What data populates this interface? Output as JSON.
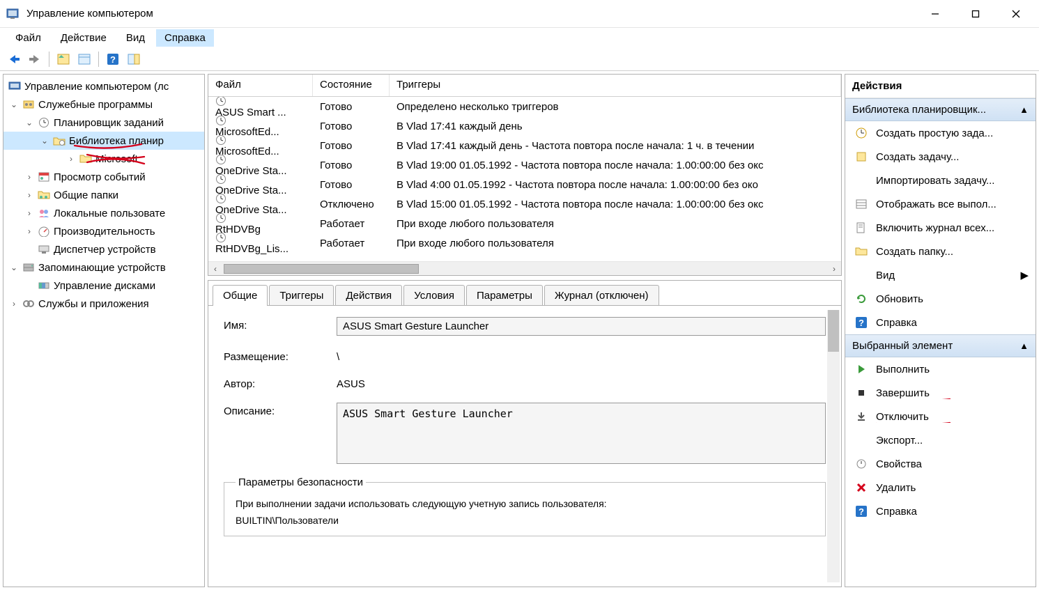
{
  "window": {
    "title": "Управление компьютером"
  },
  "menubar": [
    "Файл",
    "Действие",
    "Вид",
    "Справка"
  ],
  "tree": {
    "root": "Управление компьютером (лс",
    "n1": "Служебные программы",
    "n2": "Планировщик заданий",
    "n3": "Библиотека планир",
    "n4": "Microsoft",
    "n5": "Просмотр событий",
    "n6": "Общие папки",
    "n7": "Локальные пользовате",
    "n8": "Производительность",
    "n9": "Диспетчер устройств",
    "n10": "Запоминающие устройств",
    "n11": "Управление дисками",
    "n12": "Службы и приложения"
  },
  "tasklist": {
    "cols": {
      "file": "Файл",
      "state": "Состояние",
      "triggers": "Триггеры"
    },
    "rows": [
      {
        "f": "ASUS Smart ...",
        "s": "Готово",
        "t": "Определено несколько триггеров"
      },
      {
        "f": "MicrosoftEd...",
        "s": "Готово",
        "t": "В Vlad 17:41 каждый день"
      },
      {
        "f": "MicrosoftEd...",
        "s": "Готово",
        "t": "В Vlad 17:41 каждый день - Частота повтора после начала: 1 ч. в течении"
      },
      {
        "f": "OneDrive Sta...",
        "s": "Готово",
        "t": "В Vlad 19:00 01.05.1992 - Частота повтора после начала: 1.00:00:00 без окс"
      },
      {
        "f": "OneDrive Sta...",
        "s": "Готово",
        "t": "В Vlad 4:00 01.05.1992 - Частота повтора после начала: 1.00:00:00 без око"
      },
      {
        "f": "OneDrive Sta...",
        "s": "Отключено",
        "t": "В Vlad 15:00 01.05.1992 - Частота повтора после начала: 1.00:00:00 без окс"
      },
      {
        "f": "RtHDVBg",
        "s": "Работает",
        "t": "При входе любого пользователя"
      },
      {
        "f": "RtHDVBg_Lis...",
        "s": "Работает",
        "t": "При входе любого пользователя"
      }
    ]
  },
  "detail": {
    "tabs": [
      "Общие",
      "Триггеры",
      "Действия",
      "Условия",
      "Параметры",
      "Журнал (отключен)"
    ],
    "name_lbl": "Имя:",
    "name_val": "ASUS Smart Gesture Launcher",
    "loc_lbl": "Размещение:",
    "loc_val": "\\",
    "author_lbl": "Автор:",
    "author_val": "ASUS",
    "desc_lbl": "Описание:",
    "desc_val": "ASUS Smart Gesture Launcher",
    "security_legend": "Параметры безопасности",
    "security_text": "При выполнении задачи использовать следующую учетную запись пользователя:",
    "security_user": "BUILTIN\\Пользователи"
  },
  "actions": {
    "title": "Действия",
    "hdr1": "Библиотека планировщик...",
    "items1": [
      "Создать простую зада...",
      "Создать задачу...",
      "Импортировать задачу...",
      "Отображать все выпол...",
      "Включить журнал всех...",
      "Создать папку...",
      "Вид",
      "Обновить",
      "Справка"
    ],
    "hdr2": "Выбранный элемент",
    "items2": [
      "Выполнить",
      "Завершить",
      "Отключить",
      "Экспорт...",
      "Свойства",
      "Удалить",
      "Справка"
    ]
  }
}
